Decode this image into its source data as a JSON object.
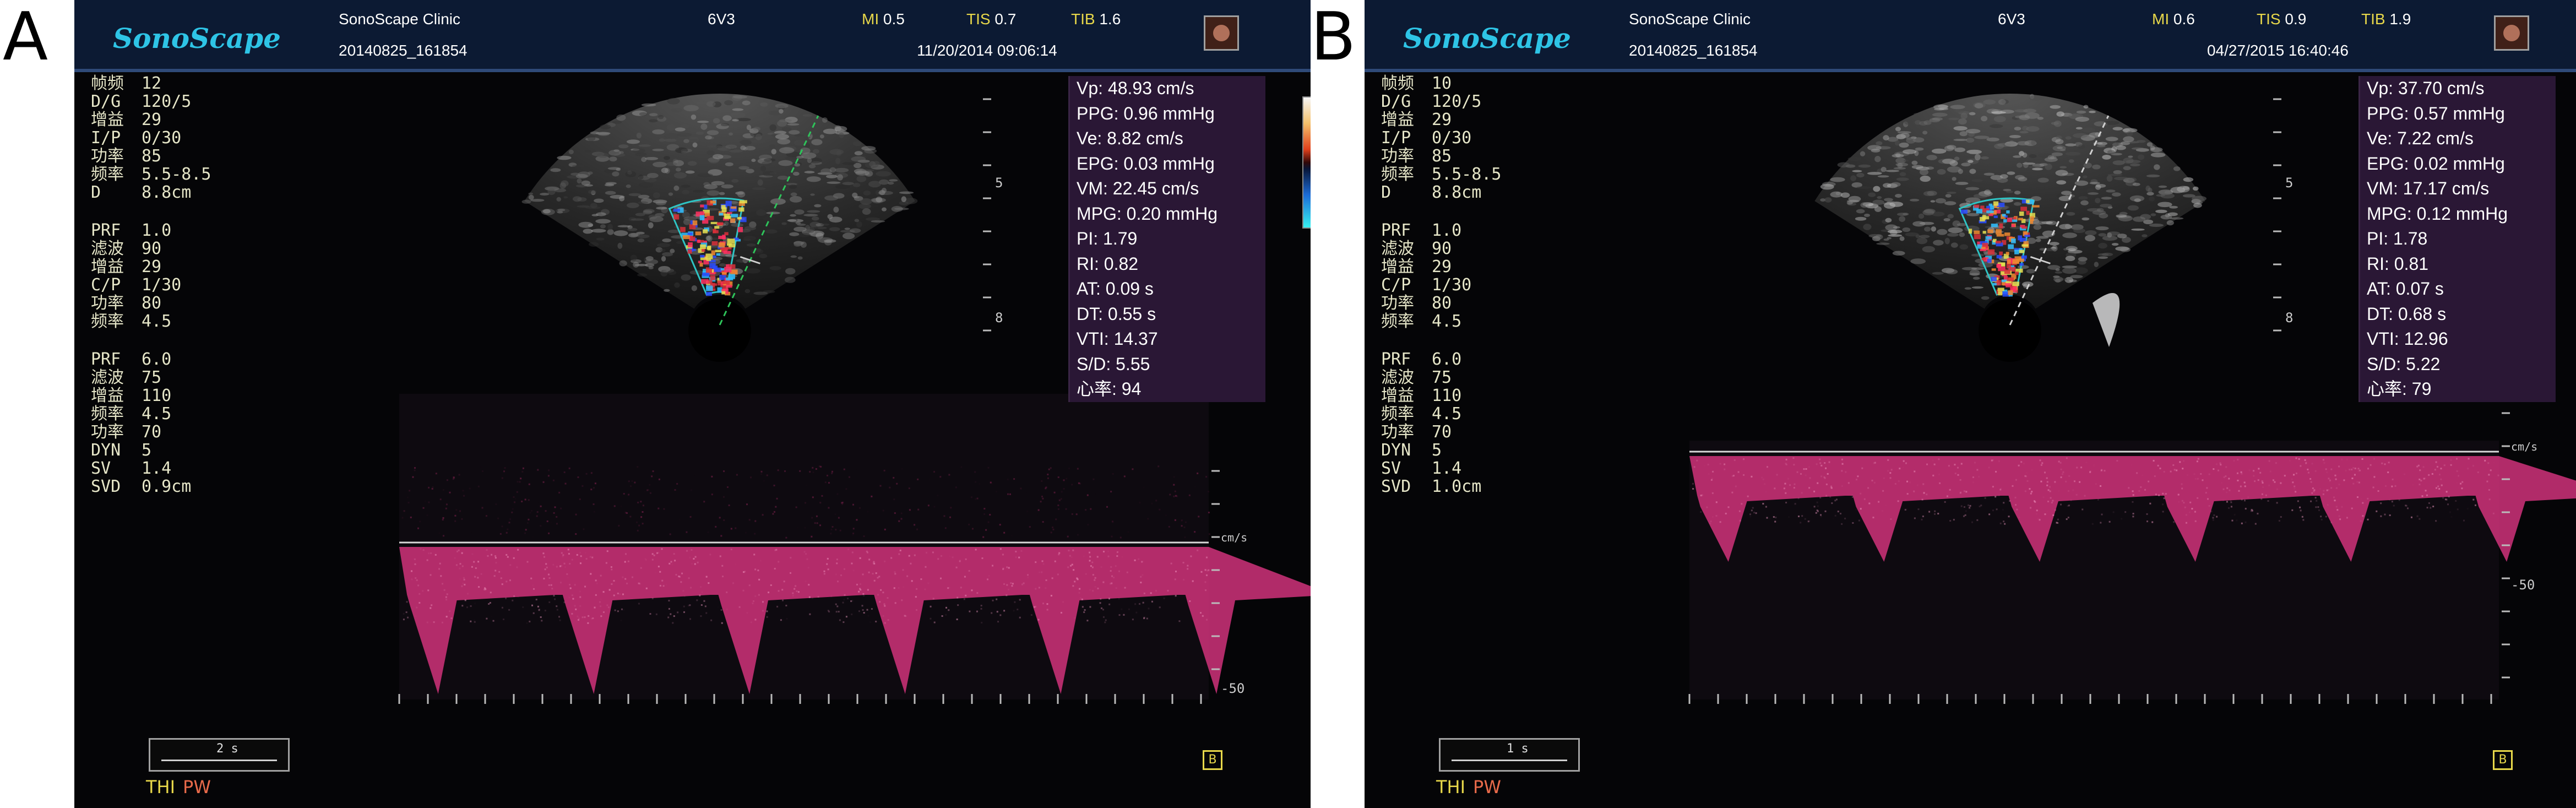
{
  "figure": {
    "panels": [
      {
        "letter": "A",
        "header": {
          "logo": "SonoScape",
          "clinic": "SonoScape Clinic",
          "probe": "6V3",
          "mi_label": "MI",
          "mi_value": "0.5",
          "tis_label": "TIS",
          "tis_value": "0.7",
          "tib_label": "TIB",
          "tib_value": "1.6",
          "patient_id": "20140825_161854",
          "datetime": "11/20/2014 09:06:14"
        },
        "params_group1": [
          {
            "k": "帧频",
            "v": "12"
          },
          {
            "k": "D/G",
            "v": "120/5"
          },
          {
            "k": "增益",
            "v": "29"
          },
          {
            "k": "I/P",
            "v": "0/30"
          },
          {
            "k": "功率",
            "v": "85"
          },
          {
            "k": "频率",
            "v": "5.5-8.5"
          },
          {
            "k": "D",
            "v": "8.8cm"
          }
        ],
        "params_group2": [
          {
            "k": "PRF",
            "v": "1.0"
          },
          {
            "k": "滤波",
            "v": "90"
          },
          {
            "k": "增益",
            "v": "29"
          },
          {
            "k": "C/P",
            "v": "1/30"
          },
          {
            "k": "功率",
            "v": "80"
          },
          {
            "k": "频率",
            "v": "4.5"
          }
        ],
        "params_group3": [
          {
            "k": "PRF",
            "v": "6.0"
          },
          {
            "k": "滤波",
            "v": "75"
          },
          {
            "k": "增益",
            "v": "110"
          },
          {
            "k": "频率",
            "v": "4.5"
          },
          {
            "k": "功率",
            "v": "70"
          },
          {
            "k": "DYN",
            "v": "5"
          },
          {
            "k": "SV",
            "v": "1.4"
          },
          {
            "k": "SVD",
            "v": "0.9cm"
          }
        ],
        "measurements": [
          "Vp: 48.93 cm/s",
          "PPG: 0.96 mmHg",
          "Ve: 8.82 cm/s",
          "EPG: 0.03 mmHg",
          "VM: 22.45 cm/s",
          "MPG: 0.20 mmHg",
          "PI: 1.79",
          "RI: 0.82",
          "AT: 0.09 s",
          "DT: 0.55 s",
          "VTI: 14.37",
          "S/D: 5.55",
          "心率:  94"
        ],
        "sector_depth_labels": [
          "5",
          "8"
        ],
        "spectral_unit": "cm/s",
        "spectral_scale_label": "-50",
        "scale_box_mark": "2 s",
        "mode_thi": "THI",
        "mode_pw": "PW",
        "corner_box": "B"
      },
      {
        "letter": "B",
        "header": {
          "logo": "SonoScape",
          "clinic": "SonoScape Clinic",
          "probe": "6V3",
          "mi_label": "MI",
          "mi_value": "0.6",
          "tis_label": "TIS",
          "tis_value": "0.9",
          "tib_label": "TIB",
          "tib_value": "1.9",
          "patient_id": "20140825_161854",
          "datetime": "04/27/2015 16:40:46"
        },
        "params_group1": [
          {
            "k": "帧频",
            "v": "10"
          },
          {
            "k": "D/G",
            "v": "120/5"
          },
          {
            "k": "增益",
            "v": "29"
          },
          {
            "k": "I/P",
            "v": "0/30"
          },
          {
            "k": "功率",
            "v": "85"
          },
          {
            "k": "频率",
            "v": "5.5-8.5"
          },
          {
            "k": "D",
            "v": "8.8cm"
          }
        ],
        "params_group2": [
          {
            "k": "PRF",
            "v": "1.0"
          },
          {
            "k": "滤波",
            "v": "90"
          },
          {
            "k": "增益",
            "v": "29"
          },
          {
            "k": "C/P",
            "v": "1/30"
          },
          {
            "k": "功率",
            "v": "80"
          },
          {
            "k": "频率",
            "v": "4.5"
          }
        ],
        "params_group3": [
          {
            "k": "PRF",
            "v": "6.0"
          },
          {
            "k": "滤波",
            "v": "75"
          },
          {
            "k": "增益",
            "v": "110"
          },
          {
            "k": "频率",
            "v": "4.5"
          },
          {
            "k": "功率",
            "v": "70"
          },
          {
            "k": "DYN",
            "v": "5"
          },
          {
            "k": "SV",
            "v": "1.4"
          },
          {
            "k": "SVD",
            "v": "1.0cm"
          }
        ],
        "measurements": [
          "Vp: 37.70 cm/s",
          "PPG: 0.57 mmHg",
          "Ve: 7.22 cm/s",
          "EPG: 0.02 mmHg",
          "VM: 17.17 cm/s",
          "MPG: 0.12 mmHg",
          "PI: 1.78",
          "RI: 0.81",
          "AT: 0.07 s",
          "DT: 0.68 s",
          "VTI: 12.96",
          "S/D: 5.22",
          "心率:  79"
        ],
        "sector_depth_labels": [
          "5",
          "8"
        ],
        "spectral_unit": "cm/s",
        "spectral_scale_label": "-50",
        "scale_box_mark": "1 s",
        "mode_thi": "THI",
        "mode_pw": "PW",
        "corner_box": "B"
      }
    ],
    "colors": {
      "doppler_spectrum": "#d0337a",
      "header_bg": "#0c1a33",
      "readout_bg": "#2a1735",
      "param_text": "#e6e6c8",
      "logo": "#2ec4e6"
    }
  }
}
